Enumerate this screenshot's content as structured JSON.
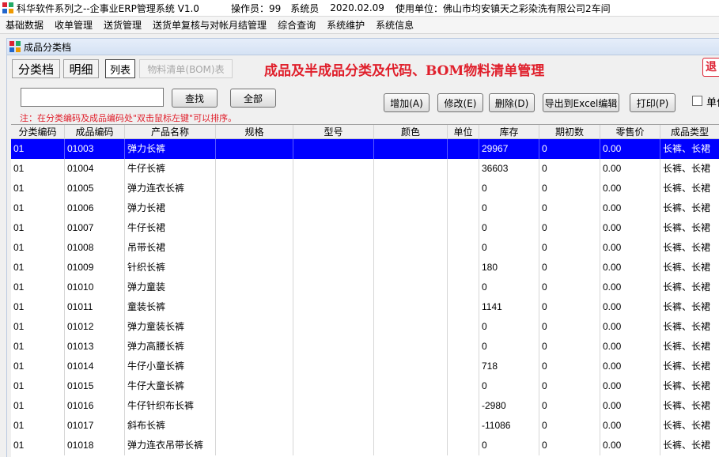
{
  "window": {
    "title": "科华软件系列之--企事业ERP管理系统 V1.0",
    "operator": "操作员：99",
    "role": "系统员",
    "date": "2020.02.09",
    "unit": "使用单位：佛山市均安镇天之彩染洗有限公司2车间"
  },
  "menu": [
    "基础数据",
    "收单管理",
    "送货管理",
    "送货单复核与对帐月结管理",
    "综合查询",
    "系统维护",
    "系统信息"
  ],
  "child_window": {
    "title": "成品分类档"
  },
  "tabs": [
    "分类档",
    "明细",
    "列表",
    "物料清单(BOM)表"
  ],
  "heading": "成品及半成品分类及代码、BOM物料清单管理",
  "exit_label": "退",
  "search": {
    "value": "",
    "placeholder": ""
  },
  "buttons": {
    "find": "查找",
    "all": "全部",
    "add": "增加(A)",
    "edit": "修改(E)",
    "delete": "删除(D)",
    "export": "导出到Excel编辑",
    "print": "打印(P)"
  },
  "checkbox_label": "单价",
  "note": "注：在分类编码及成品编码处\"双击鼠标左键\"可以排序。",
  "colors": {
    "selected_row": "#0000ff",
    "heading": "#e0202c"
  },
  "table": {
    "columns": [
      "分类编码",
      "成品编码",
      "产品名称",
      "规格",
      "型号",
      "颜色",
      "单位",
      "库存",
      "期初数",
      "零售价",
      "成品类型"
    ],
    "rows": [
      [
        "01",
        "01003",
        "弹力长裤",
        "",
        "",
        "",
        "",
        "29967",
        "0",
        "0.00",
        "长裤、长裙"
      ],
      [
        "01",
        "01004",
        "牛仔长裤",
        "",
        "",
        "",
        "",
        "36603",
        "0",
        "0.00",
        "长裤、长裙"
      ],
      [
        "01",
        "01005",
        "弹力连衣长裤",
        "",
        "",
        "",
        "",
        "0",
        "0",
        "0.00",
        "长裤、长裙"
      ],
      [
        "01",
        "01006",
        "弹力长裙",
        "",
        "",
        "",
        "",
        "0",
        "0",
        "0.00",
        "长裤、长裙"
      ],
      [
        "01",
        "01007",
        "牛仔长裙",
        "",
        "",
        "",
        "",
        "0",
        "0",
        "0.00",
        "长裤、长裙"
      ],
      [
        "01",
        "01008",
        "吊带长裙",
        "",
        "",
        "",
        "",
        "0",
        "0",
        "0.00",
        "长裤、长裙"
      ],
      [
        "01",
        "01009",
        "针织长裤",
        "",
        "",
        "",
        "",
        "180",
        "0",
        "0.00",
        "长裤、长裙"
      ],
      [
        "01",
        "01010",
        "弹力童装",
        "",
        "",
        "",
        "",
        "0",
        "0",
        "0.00",
        "长裤、长裙"
      ],
      [
        "01",
        "01011",
        "童装长裤",
        "",
        "",
        "",
        "",
        "1141",
        "0",
        "0.00",
        "长裤、长裙"
      ],
      [
        "01",
        "01012",
        "弹力童装长裤",
        "",
        "",
        "",
        "",
        "0",
        "0",
        "0.00",
        "长裤、长裙"
      ],
      [
        "01",
        "01013",
        "弹力高腰长裤",
        "",
        "",
        "",
        "",
        "0",
        "0",
        "0.00",
        "长裤、长裙"
      ],
      [
        "01",
        "01014",
        "牛仔小童长裤",
        "",
        "",
        "",
        "",
        "718",
        "0",
        "0.00",
        "长裤、长裙"
      ],
      [
        "01",
        "01015",
        "牛仔大童长裤",
        "",
        "",
        "",
        "",
        "0",
        "0",
        "0.00",
        "长裤、长裙"
      ],
      [
        "01",
        "01016",
        "牛仔针织布长裤",
        "",
        "",
        "",
        "",
        "-2980",
        "0",
        "0.00",
        "长裤、长裙"
      ],
      [
        "01",
        "01017",
        "斜布长裤",
        "",
        "",
        "",
        "",
        "-11086",
        "0",
        "0.00",
        "长裤、长裙"
      ],
      [
        "01",
        "01018",
        "弹力连衣吊带长裤",
        "",
        "",
        "",
        "",
        "0",
        "0",
        "0.00",
        "长裤、长裙"
      ]
    ],
    "selected_row": 0
  }
}
